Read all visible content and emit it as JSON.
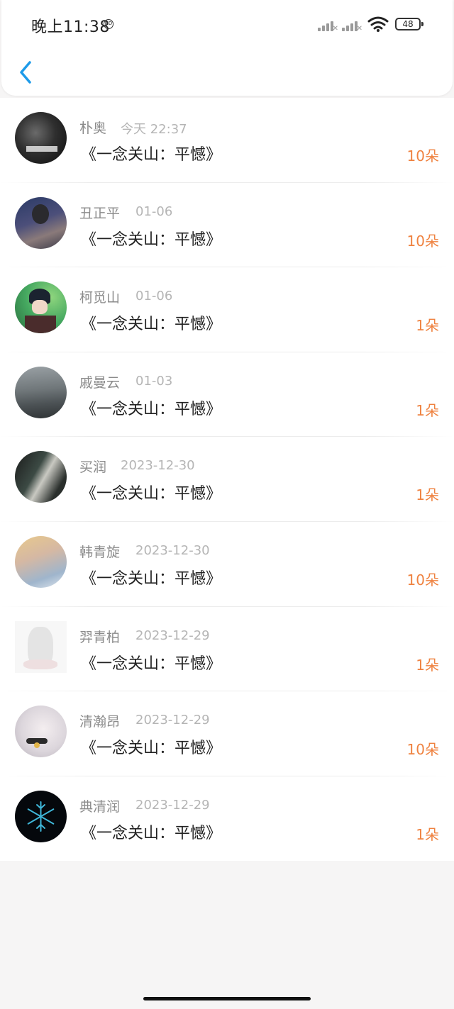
{
  "status_bar": {
    "time": "晚上11:38",
    "battery": "48"
  },
  "colors": {
    "accent": "#1e9be9",
    "count": "#ef8240"
  },
  "records": [
    {
      "name": "朴奥",
      "time": "今天 22:37",
      "title": "《一念关山：平憾》",
      "count": "10朵"
    },
    {
      "name": "丑正平",
      "time": "01-06",
      "title": "《一念关山：平憾》",
      "count": "10朵"
    },
    {
      "name": "柯觅山",
      "time": "01-06",
      "title": "《一念关山：平憾》",
      "count": "1朵"
    },
    {
      "name": "戚曼云",
      "time": "01-03",
      "title": "《一念关山：平憾》",
      "count": "1朵"
    },
    {
      "name": "买润",
      "time": "2023-12-30",
      "title": "《一念关山：平憾》",
      "count": "1朵"
    },
    {
      "name": "韩青旋",
      "time": "2023-12-30",
      "title": "《一念关山：平憾》",
      "count": "10朵"
    },
    {
      "name": "羿青柏",
      "time": "2023-12-29",
      "title": "《一念关山：平憾》",
      "count": "1朵"
    },
    {
      "name": "清瀚昂",
      "time": "2023-12-29",
      "title": "《一念关山：平憾》",
      "count": "10朵"
    },
    {
      "name": "典清润",
      "time": "2023-12-29",
      "title": "《一念关山：平憾》",
      "count": "1朵"
    }
  ]
}
